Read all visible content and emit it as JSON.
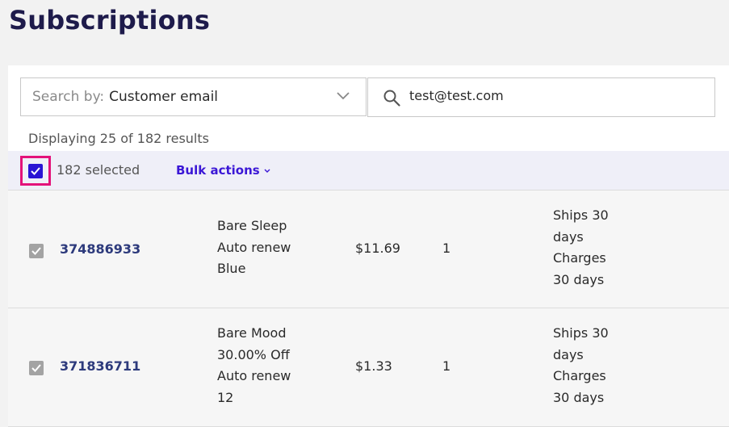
{
  "page": {
    "title": "Subscriptions"
  },
  "search": {
    "by_prefix": "Search by:",
    "by_value": "Customer email",
    "query": "test@test.com"
  },
  "results_text": "Displaying 25 of 182 results",
  "bulk": {
    "selected_text": "182 selected",
    "actions_label": "Bulk actions"
  },
  "rows": [
    {
      "id": "374886933",
      "product": [
        "Bare Sleep",
        "Auto renew",
        "Blue"
      ],
      "price": "$11.69",
      "qty": "1",
      "schedule": [
        "Ships 30",
        "days",
        "Charges",
        "30 days"
      ]
    },
    {
      "id": "371836711",
      "product": [
        "Bare Mood",
        "30.00% Off",
        "Auto renew",
        "12"
      ],
      "price": "$1.33",
      "qty": "1",
      "schedule": [
        "Ships 30",
        "days",
        "Charges",
        "30 days"
      ]
    }
  ],
  "colors": {
    "title": "#1e1b4b",
    "accent": "#3b17d6",
    "highlight": "#e3127a"
  }
}
